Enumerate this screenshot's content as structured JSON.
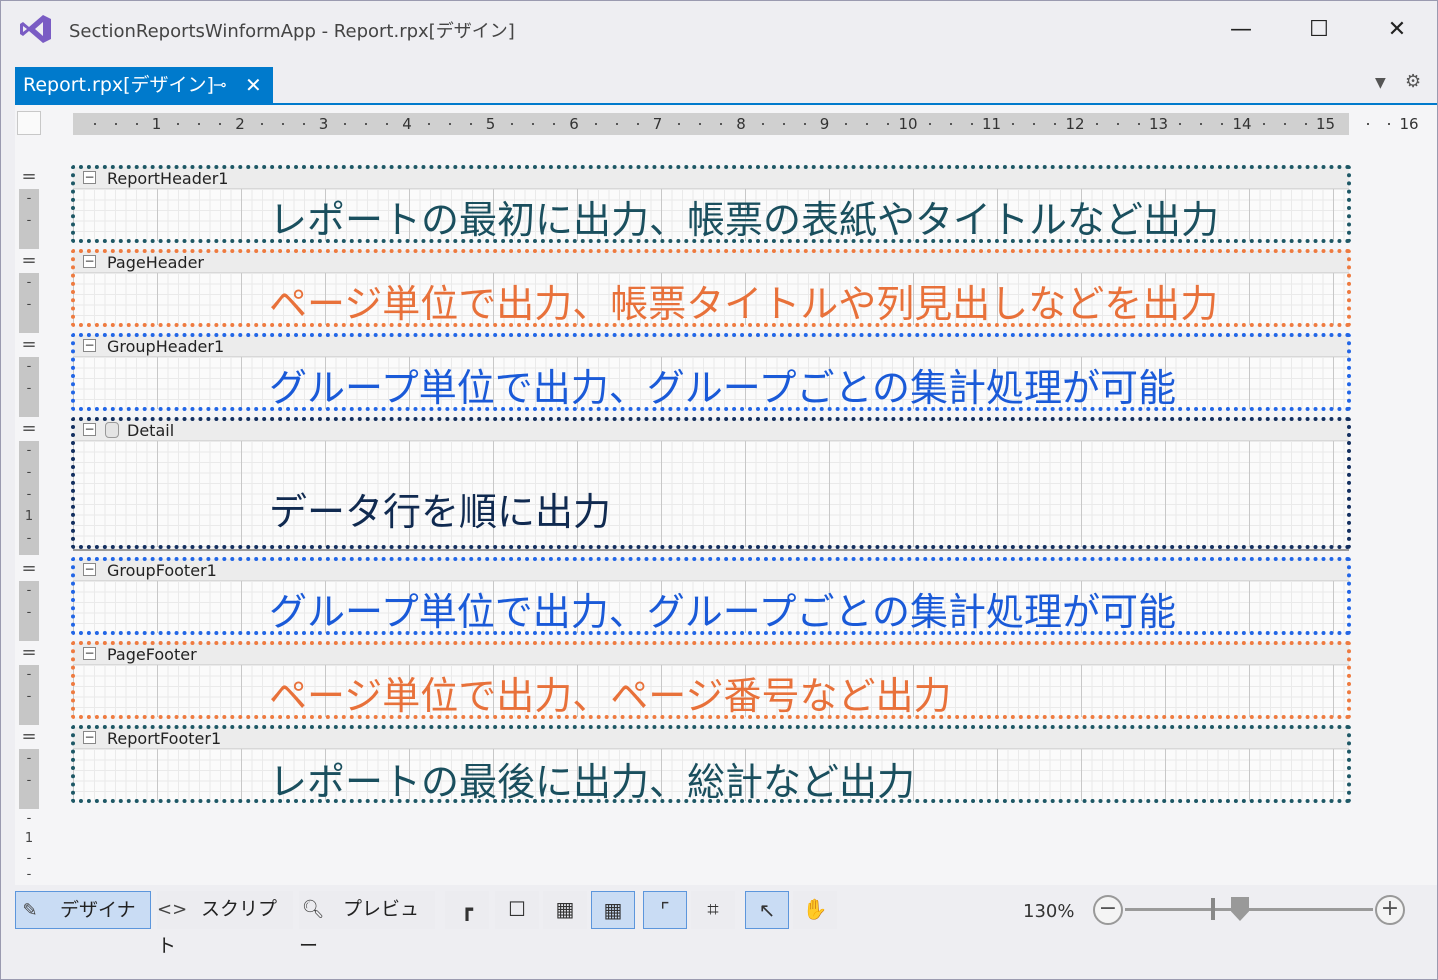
{
  "window": {
    "title": "SectionReportsWinformApp - Report.rpx[デザイン]",
    "minimize": "—",
    "maximize": "☐",
    "close": "✕"
  },
  "tab": {
    "label": "Report.rpx[デザイン]",
    "pin": "⊸",
    "close": "✕",
    "dropdown": "▼",
    "gear": "⚙"
  },
  "ruler": {
    "numbers": [
      "1",
      "2",
      "3",
      "4",
      "5",
      "6",
      "7",
      "8",
      "9",
      "10",
      "11",
      "12",
      "13",
      "14",
      "15",
      "16"
    ]
  },
  "sections": [
    {
      "name": "ReportHeader1",
      "description": "レポートの最初に出力、帳票の表紙やタイトルなど出力",
      "color": "#1e5866"
    },
    {
      "name": "PageHeader",
      "description": "ページ単位で出力、帳票タイトルや列見出しなどを出力",
      "color": "#ee7b40"
    },
    {
      "name": "GroupHeader1",
      "description": "グループ単位で出力、グループごとの集計処理が可能",
      "color": "#2266e6"
    },
    {
      "name": "Detail",
      "description": "データ行を順に出力",
      "color": "#143060"
    },
    {
      "name": "GroupFooter1",
      "description": "グループ単位で出力、グループごとの集計処理が可能",
      "color": "#2266e6"
    },
    {
      "name": "PageFooter",
      "description": "ページ単位で出力、ページ番号など出力",
      "color": "#ee7b40"
    },
    {
      "name": "ReportFooter1",
      "description": "レポートの最後に出力、総計など出力",
      "color": "#1e5866"
    }
  ],
  "vruler": {
    "mark1": "1",
    "mark2": "1"
  },
  "toolbar": {
    "designer": "デザイナ",
    "script": "スクリプト",
    "preview": "プレビュー",
    "zoom": "130%",
    "zoom_minus": "−",
    "zoom_plus": "+"
  }
}
